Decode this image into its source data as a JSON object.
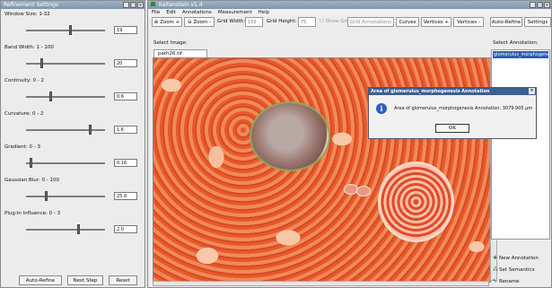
{
  "left_panel": {
    "title": "Refinement Settings",
    "params": [
      {
        "label": "Window Size: 1-32",
        "value": "19",
        "position": 0.56
      },
      {
        "label": "Band Width: 1 - 100",
        "value": "20",
        "position": 0.19
      },
      {
        "label": "Continuity: 0 - 2",
        "value": "0.6",
        "position": 0.3
      },
      {
        "label": "Curvature: 0 - 2",
        "value": "1.6",
        "position": 0.82
      },
      {
        "label": "Gradient: 0 - 3",
        "value": "0.16",
        "position": 0.05
      },
      {
        "label": "Gaussian Blur: 0 - 100",
        "value": "25.0",
        "position": 0.25
      },
      {
        "label": "Plug-In Influence: 0 - 3",
        "value": "2.0",
        "position": 0.67
      }
    ],
    "buttons": {
      "auto_refine": "Auto-Refine",
      "next_step": "Next Step",
      "reset": "Reset"
    }
  },
  "main_window": {
    "title": "Kaltenstein v1.4",
    "menu": [
      "File",
      "Edit",
      "Annotations",
      "Measurement",
      "Help"
    ],
    "toolbar": {
      "zoom_in": "Zoom +",
      "zoom_out": "Zoom -",
      "grid_width_label": "Grid Width:",
      "grid_width_value": "150",
      "grid_height_label": "Grid Height:",
      "grid_height_value": "75",
      "show_grid": "Show Grid",
      "grid_annotation": "Grid Annotations",
      "curves": "Curves",
      "vertices_plus": "Vertices +",
      "vertices_minus": "Vertices -",
      "auto_refine": "Auto-Refine",
      "settings": "Settings"
    },
    "select_image_label": "Select Image:",
    "image_tab": "path26.tif",
    "select_annotation_label": "Select Annotation:",
    "annotations": [
      "glomerulus_morphogenesis"
    ],
    "annotation_buttons": {
      "new": "New Annotation",
      "semantics": "Set Semantics",
      "rename": "Rename"
    }
  },
  "dialog": {
    "title": "Area of glomerulus_morphogenesis Annotation",
    "message": "Area of glomerulus_morphogenesis Annotation: 3079.905 µm",
    "ok": "OK"
  },
  "colors": {
    "titlebar": "#8da3bb",
    "dialog_title": "#3d5f91",
    "selection": "#2f5cb0",
    "tissue": "#e76a3a"
  }
}
